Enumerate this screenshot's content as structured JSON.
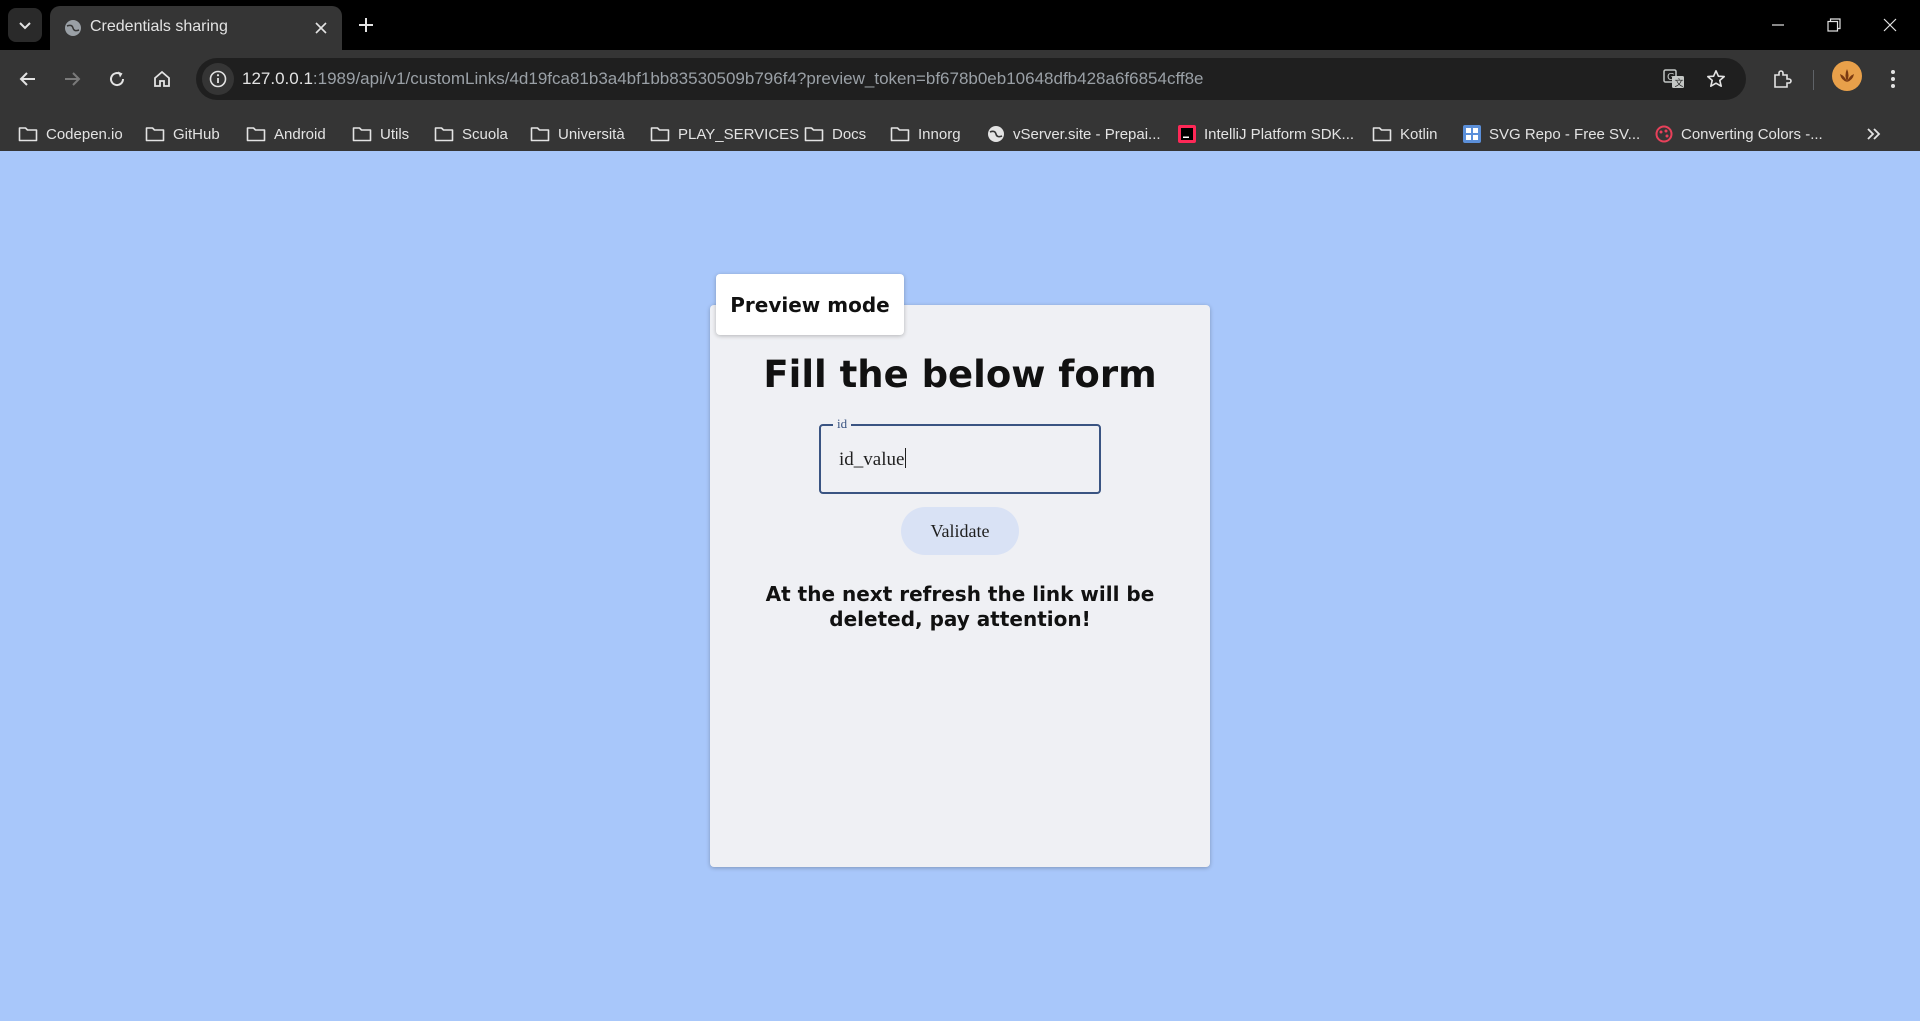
{
  "browser": {
    "tab": {
      "title": "Credentials sharing"
    },
    "url": {
      "host": "127.0.0.1",
      "rest": ":1989/api/v1/customLinks/4d19fca81b3a4bf1bb83530509b796f4?preview_token=bf678b0eb10648dfb428a6f6854cff8e"
    },
    "bookmarks": [
      {
        "label": "Codepen.io",
        "icon": "folder-icon"
      },
      {
        "label": "GitHub",
        "icon": "folder-icon"
      },
      {
        "label": "Android",
        "icon": "folder-icon"
      },
      {
        "label": "Utils",
        "icon": "folder-icon"
      },
      {
        "label": "Scuola",
        "icon": "folder-icon"
      },
      {
        "label": "Università",
        "icon": "folder-icon"
      },
      {
        "label": "PLAY_SERVICES",
        "icon": "folder-icon"
      },
      {
        "label": "Docs",
        "icon": "folder-icon"
      },
      {
        "label": "Innorg",
        "icon": "folder-icon"
      },
      {
        "label": "vServer.site - Prepai...",
        "icon": "globe-icon"
      },
      {
        "label": "IntelliJ Platform SDK...",
        "icon": "intellij-icon"
      },
      {
        "label": "Kotlin",
        "icon": "folder-icon"
      },
      {
        "label": "SVG Repo - Free SV...",
        "icon": "svgrepo-icon"
      },
      {
        "label": "Converting Colors -...",
        "icon": "palette-icon"
      }
    ]
  },
  "page": {
    "preview_badge": "Preview mode",
    "form_title": "Fill the below form",
    "field": {
      "label": "id",
      "value": "id_value"
    },
    "validate_label": "Validate",
    "warning": "At the next refresh the link will be deleted, pay attention!"
  },
  "colors": {
    "page_background": "#a8c7fa",
    "card_background": "#eff0f4",
    "field_border": "#3a5482",
    "button_background": "#d9e2f5"
  }
}
